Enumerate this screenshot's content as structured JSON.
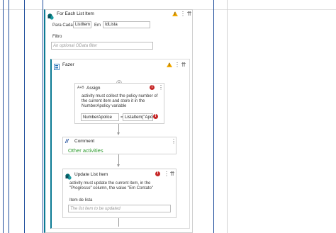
{
  "foreach": {
    "title": "For Each List Item",
    "for_each_label": "Para Cada",
    "item_value": "ListItem",
    "in_label": "Em",
    "list_value": "IdLista",
    "filter_label": "Filtro",
    "filter_placeholder": "An optional OData filter"
  },
  "sequence": {
    "title": "Fazer"
  },
  "assign": {
    "title": "Assign",
    "icon_text": "A+B",
    "error_line1": "activity must collect the policy number of",
    "error_line2": "the current item and store it in the",
    "error_line3": "NumberApolicy variable",
    "left_value": "NumberApolice",
    "equals": "=",
    "right_value": "ListaItem(\"Apól"
  },
  "comment": {
    "title": "Comment",
    "body": "Other activities"
  },
  "update": {
    "title": "Update List Item",
    "desc_line1": "activity must update the current item, in the",
    "desc_line2": "\"Progresso\" column, the value \"Em Contato\"",
    "field_label": "Item de lista",
    "field_placeholder": "The list item to be updated"
  },
  "colors": {
    "frame_blue": "#1f4e9c",
    "teal": "#0a7a93",
    "warning": "#f2a900",
    "error": "#c62828",
    "comment_green": "#2e9b2e"
  },
  "icons": {
    "sharepoint": "sharepoint-icon",
    "collapse": "chevron-double-up-icon",
    "more": "kebab-menu-icon",
    "warning": "warning-icon",
    "error": "error-icon",
    "add": "plus-circle-icon",
    "sequence": "sequence-icon",
    "comment": "comment-slashes-icon"
  }
}
